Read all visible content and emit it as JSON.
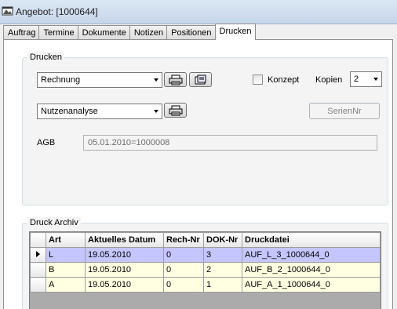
{
  "window": {
    "title": "Angebot: [1000644]",
    "icon": "app-icon"
  },
  "tabs": [
    {
      "label": "Auftrag",
      "active": false
    },
    {
      "label": "Termine",
      "active": false
    },
    {
      "label": "Dokumente",
      "active": false
    },
    {
      "label": "Notizen",
      "active": false
    },
    {
      "label": "Positionen",
      "active": false
    },
    {
      "label": "Drucken",
      "active": true
    }
  ],
  "drucken": {
    "group_title": "Drucken",
    "report_combo": {
      "value": "Rechnung"
    },
    "report2_combo": {
      "value": "Nutzenanalyse"
    },
    "konzept": {
      "label": "Konzept",
      "checked": false
    },
    "kopien": {
      "label": "Kopien",
      "value": "2"
    },
    "seriennr_button": "SerienNr",
    "agb": {
      "label": "AGB",
      "value": "05.01.2010=1000008"
    }
  },
  "archiv": {
    "group_title": "Druck Archiv",
    "columns": [
      "Art",
      "Aktuelles Datum",
      "Rech-Nr",
      "DOK-Nr",
      "Druckdatei"
    ],
    "rows": [
      {
        "art": "L",
        "datum": "19.05.2010",
        "rech_nr": "0",
        "dok_nr": "3",
        "druckdatei": "AUF_L_3_1000644_0",
        "selected": true
      },
      {
        "art": "B",
        "datum": "19.05.2010",
        "rech_nr": "0",
        "dok_nr": "2",
        "druckdatei": "AUF_B_2_1000644_0",
        "selected": false
      },
      {
        "art": "A",
        "datum": "19.05.2010",
        "rech_nr": "0",
        "dok_nr": "1",
        "druckdatei": "AUF_A_1_1000644_0",
        "selected": false
      }
    ]
  },
  "colors": {
    "selected_row": "#c6c6ff",
    "normal_row": "#ffffe1",
    "grid_background": "#ababab"
  }
}
